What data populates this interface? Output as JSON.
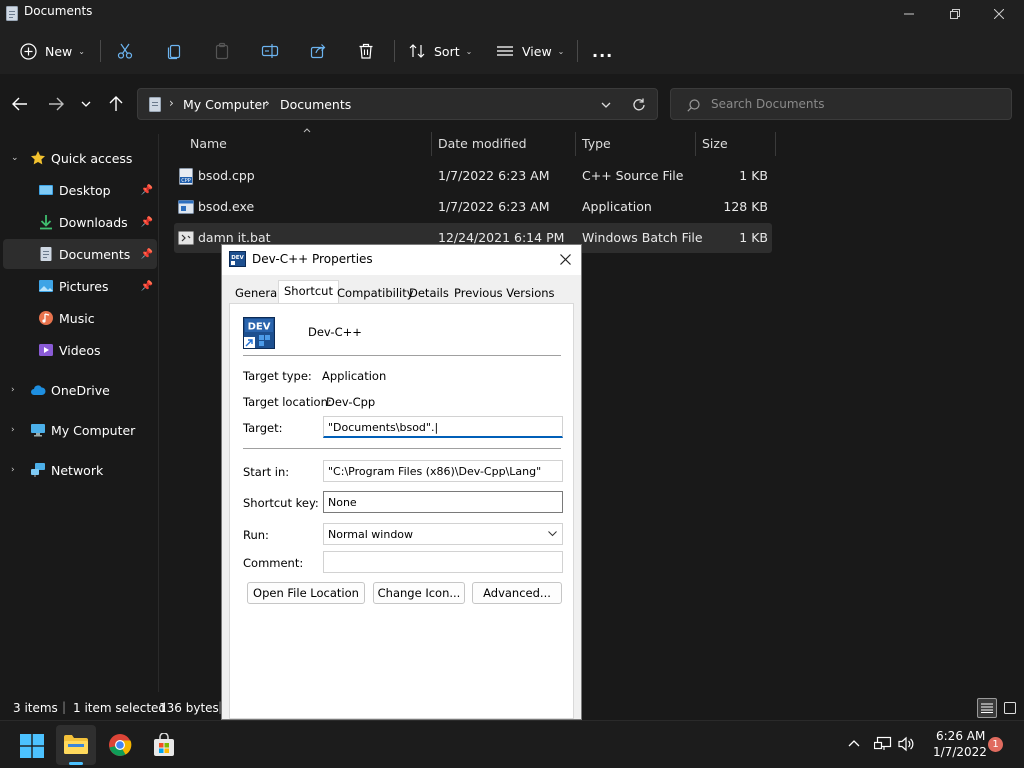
{
  "window": {
    "title": "Documents"
  },
  "toolbar": {
    "new_label": "New",
    "sort_label": "Sort",
    "view_label": "View",
    "more_label": "..."
  },
  "address": {
    "segments": [
      "My Computer",
      "Documents"
    ],
    "search_placeholder": "Search Documents"
  },
  "sidebar": {
    "items": [
      {
        "label": "Quick access",
        "icon": "star-icon"
      },
      {
        "label": "Desktop",
        "icon": "desktop-icon"
      },
      {
        "label": "Downloads",
        "icon": "download-icon"
      },
      {
        "label": "Documents",
        "icon": "document-icon"
      },
      {
        "label": "Pictures",
        "icon": "picture-icon"
      },
      {
        "label": "Music",
        "icon": "music-icon"
      },
      {
        "label": "Videos",
        "icon": "video-icon"
      },
      {
        "label": "OneDrive",
        "icon": "cloud-icon"
      },
      {
        "label": "My Computer",
        "icon": "monitor-icon"
      },
      {
        "label": "Network",
        "icon": "network-icon"
      }
    ]
  },
  "files": {
    "columns": [
      "Name",
      "Date modified",
      "Type",
      "Size"
    ],
    "rows": [
      {
        "name": "bsod.cpp",
        "date": "1/7/2022 6:23 AM",
        "type": "C++ Source File",
        "size": "1 KB"
      },
      {
        "name": "bsod.exe",
        "date": "1/7/2022 6:23 AM",
        "type": "Application",
        "size": "128 KB"
      },
      {
        "name": "damn it.bat",
        "date": "12/24/2021 6:14 PM",
        "type": "Windows Batch File",
        "size": "1 KB"
      }
    ]
  },
  "status": {
    "items": "3 items",
    "selected": "1 item selected",
    "size": "136 bytes"
  },
  "dialog": {
    "title": "Dev-C++ Properties",
    "tabs": [
      "General",
      "Shortcut",
      "Compatibility",
      "Details",
      "Previous Versions"
    ],
    "active_tab": "Shortcut",
    "app_name": "Dev-C++",
    "icon_text": "DEV",
    "target_type_label": "Target type:",
    "target_type": "Application",
    "target_location_label": "Target location:",
    "target_location": "Dev-Cpp",
    "target_label": "Target:",
    "target_value": "\"Documents\\bsod\".|",
    "start_in_label": "Start in:",
    "start_in_value": "\"C:\\Program Files (x86)\\Dev-Cpp\\Lang\"",
    "shortcut_key_label": "Shortcut key:",
    "shortcut_key_value": "None",
    "run_label": "Run:",
    "run_value": "Normal window",
    "comment_label": "Comment:",
    "comment_value": "",
    "buttons": [
      "Open File Location",
      "Change Icon...",
      "Advanced..."
    ]
  },
  "taskbar": {
    "time": "6:26 AM",
    "date": "1/7/2022",
    "notification_count": "1"
  },
  "colors": {
    "accent": "#005fb8",
    "folder": "#f3c13a",
    "dark_bg": "#191919"
  }
}
